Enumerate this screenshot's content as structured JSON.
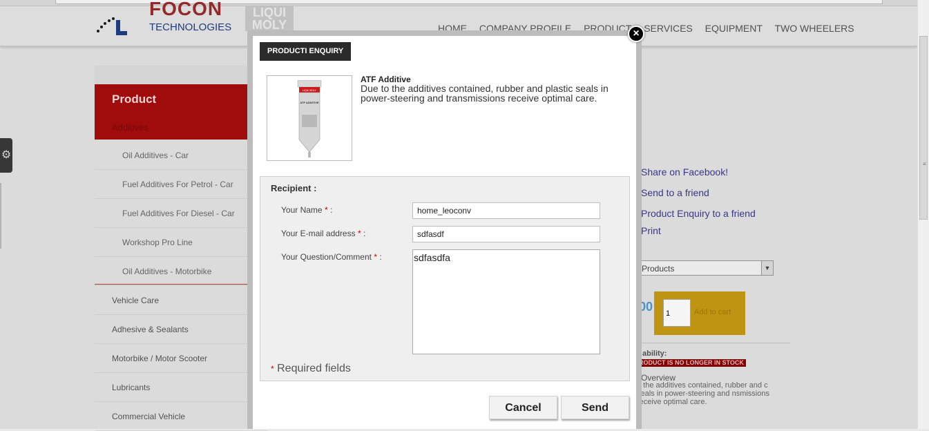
{
  "header": {
    "brand": "FOCON",
    "brand_sub": "TECHNOLOGIES",
    "partner_logo": "LIQUI MOLY",
    "nav": [
      "HOME",
      "COMPANY PROFILE",
      "PRODUCT",
      "SERVICES",
      "EQUIPMENT",
      "TWO WHEELERS"
    ]
  },
  "sidebar": {
    "title": "Product",
    "active_section": "Additives",
    "sub_items": [
      "Oil Additives - Car",
      "Fuel Additives For Petrol - Car",
      "Fuel Additives For Diesel - Car",
      "Workshop Pro Line",
      "Oil Additives - Motorbike"
    ],
    "items": [
      "Vehicle Care",
      "Adhesive & Sealants",
      "Motorbike / Motor Scooter",
      "Lubricants",
      "Commercial Vehicle"
    ]
  },
  "right_panel": {
    "links": [
      "Share on Facebook!",
      "Send to a friend",
      "Product Enquiry to a friend",
      "Print"
    ],
    "select_value": "Products",
    "price_fragment": ".00",
    "qty": "1",
    "add_to_cart": "Add to cart",
    "availability_label": "ability:",
    "stock_status": "RODUCT IS NO LONGER IN STOCK",
    "overview_label": "Overview",
    "overview_text": "o the additives contained, rubber and c seals in power-steering and nsmissions receive optimal care."
  },
  "modal": {
    "heading": "PRODUCTI ENQUIRY",
    "product_name": "ATF Additive",
    "product_desc": "Due to the additives contained, rubber and plastic seals in power-steering and transmissions receive optimal care.",
    "tube_brand": "LIQUI MOLY",
    "tube_label": "ATF ADDITIVE",
    "recipient_label": "Recipient :",
    "name_label": "Your Name",
    "name_value": "home_leoconv",
    "email_label": "Your E-mail address",
    "email_value": "sdfasdf",
    "comment_label": "Your Question/Comment",
    "comment_value": "sdfasdfa",
    "required_note": "Required fields",
    "asterisk": "*",
    "colon": " :",
    "cancel": "Cancel",
    "send": "Send",
    "close_glyph": "×"
  },
  "colors": {
    "accent_red": "#a70c0c",
    "link_blue": "#3a3a8e",
    "cart_gold": "#c79b14"
  }
}
